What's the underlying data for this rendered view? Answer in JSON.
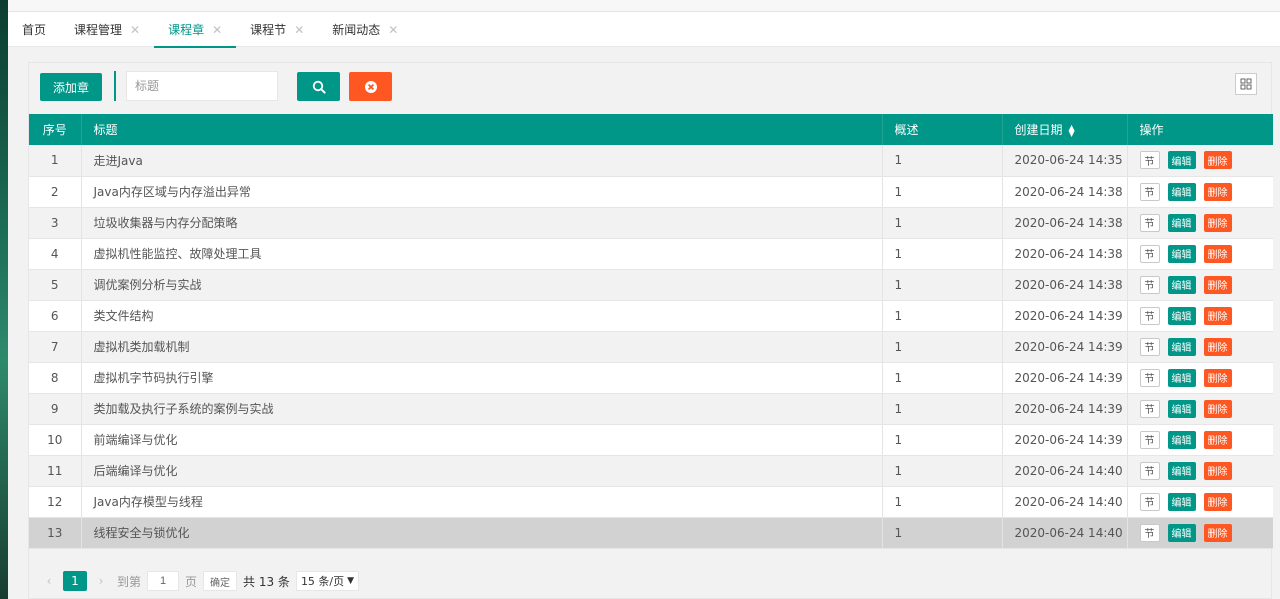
{
  "tabs": [
    {
      "label": "首页",
      "closable": false,
      "active": false
    },
    {
      "label": "课程管理",
      "closable": true,
      "active": false
    },
    {
      "label": "课程章",
      "closable": true,
      "active": true
    },
    {
      "label": "课程节",
      "closable": true,
      "active": false
    },
    {
      "label": "新闻动态",
      "closable": true,
      "active": false
    }
  ],
  "toolbar": {
    "add_label": "添加章",
    "search_placeholder": "标题",
    "search_value": "",
    "search_icon": "search-icon",
    "reset_icon": "close-circle-icon",
    "columns_icon": "grid-icon"
  },
  "colors": {
    "primary": "#009688",
    "danger": "#ff5722"
  },
  "table": {
    "headers": {
      "idx": "序号",
      "title": "标题",
      "summary": "概述",
      "created": "创建日期",
      "ops": "操作"
    },
    "op_labels": {
      "section": "节",
      "edit": "编辑",
      "delete": "删除"
    },
    "rows": [
      {
        "idx": "1",
        "title": "走进Java",
        "summary": "1",
        "created": "2020-06-24 14:35"
      },
      {
        "idx": "2",
        "title": "Java内存区域与内存溢出异常",
        "summary": "1",
        "created": "2020-06-24 14:38"
      },
      {
        "idx": "3",
        "title": "垃圾收集器与内存分配策略",
        "summary": "1",
        "created": "2020-06-24 14:38"
      },
      {
        "idx": "4",
        "title": "虚拟机性能监控、故障处理工具",
        "summary": "1",
        "created": "2020-06-24 14:38"
      },
      {
        "idx": "5",
        "title": "调优案例分析与实战",
        "summary": "1",
        "created": "2020-06-24 14:38"
      },
      {
        "idx": "6",
        "title": "类文件结构",
        "summary": "1",
        "created": "2020-06-24 14:39"
      },
      {
        "idx": "7",
        "title": "虚拟机类加载机制",
        "summary": "1",
        "created": "2020-06-24 14:39"
      },
      {
        "idx": "8",
        "title": "虚拟机字节码执行引擎",
        "summary": "1",
        "created": "2020-06-24 14:39"
      },
      {
        "idx": "9",
        "title": "类加载及执行子系统的案例与实战",
        "summary": "1",
        "created": "2020-06-24 14:39"
      },
      {
        "idx": "10",
        "title": "前端编译与优化",
        "summary": "1",
        "created": "2020-06-24 14:39"
      },
      {
        "idx": "11",
        "title": "后端编译与优化",
        "summary": "1",
        "created": "2020-06-24 14:40"
      },
      {
        "idx": "12",
        "title": "Java内存模型与线程",
        "summary": "1",
        "created": "2020-06-24 14:40"
      },
      {
        "idx": "13",
        "title": "线程安全与锁优化",
        "summary": "1",
        "created": "2020-06-24 14:40"
      }
    ]
  },
  "pagination": {
    "current_page": "1",
    "goto_label": "到第",
    "goto_value": "1",
    "page_unit": "页",
    "confirm_label": "确定",
    "total_label": "共 13 条",
    "page_size": "15 条/页"
  }
}
